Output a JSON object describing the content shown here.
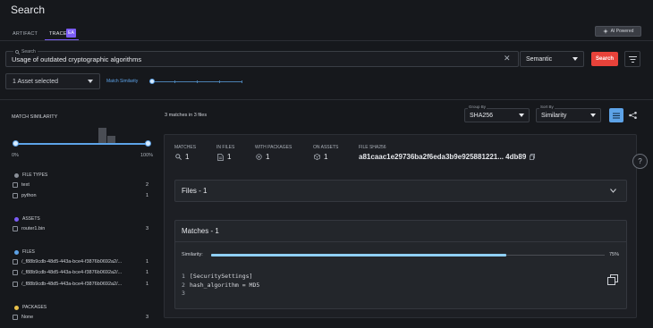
{
  "page": {
    "title": "Search"
  },
  "ai_button": {
    "label": "AI Powered"
  },
  "tabs": [
    {
      "label": "ARTIFACT"
    },
    {
      "label": "TRACE",
      "badge": "EA"
    }
  ],
  "search": {
    "label": "Search",
    "value": "Usage of outdated cryptographic algorithms",
    "mode": "Semantic",
    "button_label": "Search"
  },
  "asset_select": {
    "value": "1 Asset selected"
  },
  "match_similarity": {
    "label": "Match Similarity"
  },
  "left_panel": {
    "heading": "MATCH SIMILARITY",
    "range_min": "0%",
    "range_max": "100%",
    "sections": [
      {
        "title": "FILE TYPES",
        "color": "#8a8f98",
        "items": [
          {
            "label": "text",
            "count": "2"
          },
          {
            "label": "python",
            "count": "1"
          }
        ]
      },
      {
        "title": "ASSETS",
        "color": "#7b5cf5",
        "items": [
          {
            "label": "router1.bin",
            "count": "3"
          }
        ]
      },
      {
        "title": "FILES",
        "color": "#5da3e8",
        "items": [
          {
            "label": "/_f88b9cdb-48d5-443a-bce4-f3876b0692a2/...",
            "count": "1"
          },
          {
            "label": "/_f88b9cdb-48d5-443a-bce4-f3876b0692a2/...",
            "count": "1"
          },
          {
            "label": "/_f88b9cdb-48d5-443a-bce4-f3876b0692a2/...",
            "count": "1"
          }
        ]
      },
      {
        "title": "PACKAGES",
        "color": "#e8c04a",
        "items": [
          {
            "label": "None",
            "count": "3"
          }
        ]
      }
    ]
  },
  "results": {
    "summary": "3 matches in 3 files",
    "group_by": {
      "label": "Group By",
      "value": "SHA256"
    },
    "sort_by": {
      "label": "Sort By",
      "value": "Similarity"
    }
  },
  "group": {
    "stats": [
      {
        "label": "MATCHES",
        "value": "1",
        "icon": "search-icon"
      },
      {
        "label": "IN FILES",
        "value": "1",
        "icon": "file-icon"
      },
      {
        "label": "WITH PACKAGES",
        "value": "1",
        "icon": "package-icon"
      },
      {
        "label": "ON ASSETS",
        "value": "1",
        "icon": "cube-icon"
      }
    ],
    "sha_label": "FILE SHA256",
    "sha_value": "a81caac1e29736ba2f6eda3b9e925881221... 4db89",
    "files_title": "Files - 1",
    "matches_title": "Matches - 1",
    "similarity_label": "Similarity:",
    "similarity_value": 0.75,
    "similarity_text": "75%",
    "code_lines": [
      {
        "num": "1",
        "text": "[SecuritySettings]"
      },
      {
        "num": "2",
        "text": "hash_algorithm = MD5"
      },
      {
        "num": "3",
        "text": ""
      }
    ]
  }
}
